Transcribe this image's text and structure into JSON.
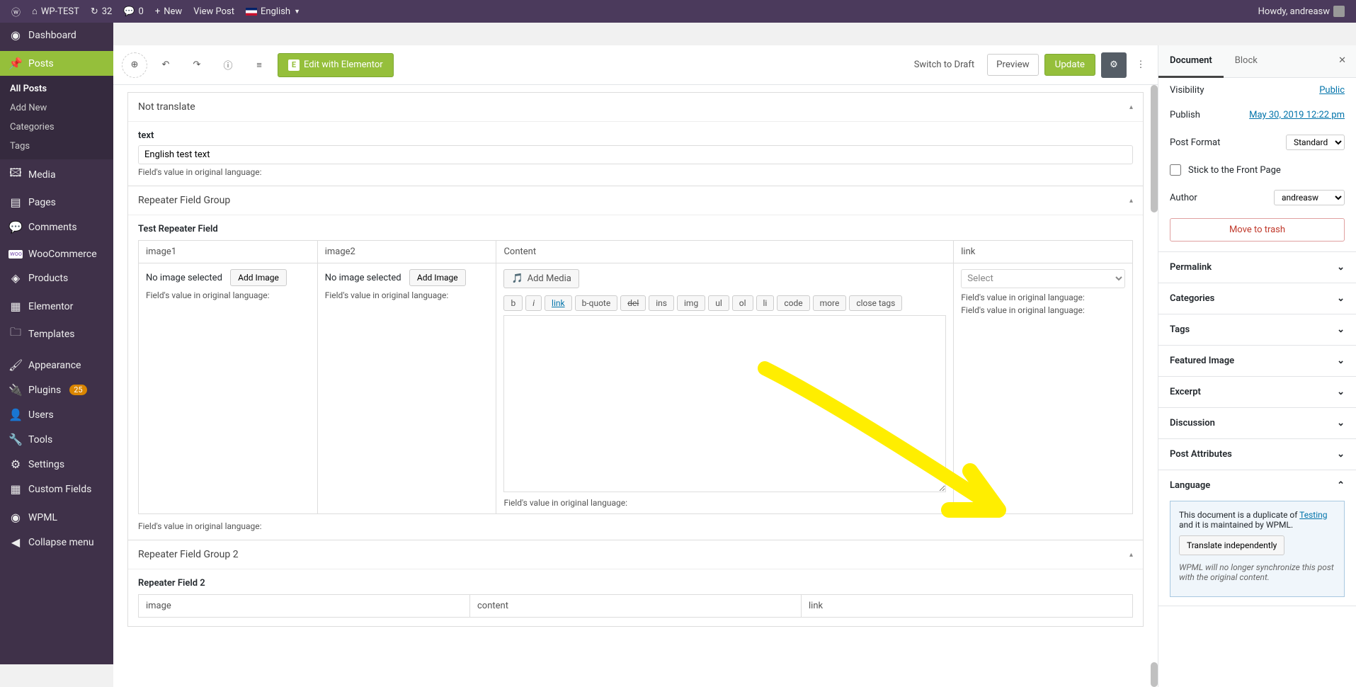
{
  "adminBar": {
    "siteName": "WP-TEST",
    "updates": "32",
    "comments": "0",
    "new": "New",
    "viewPost": "View Post",
    "language": "English",
    "howdy": "Howdy, andreasw"
  },
  "sidebar": {
    "dashboard": "Dashboard",
    "posts": "Posts",
    "postsSub": {
      "all": "All Posts",
      "addNew": "Add New",
      "categories": "Categories",
      "tags": "Tags"
    },
    "media": "Media",
    "pages": "Pages",
    "comments": "Comments",
    "woo": "WooCommerce",
    "products": "Products",
    "elementor": "Elementor",
    "templates": "Templates",
    "appearance": "Appearance",
    "plugins": "Plugins",
    "pluginsBadge": "25",
    "users": "Users",
    "tools": "Tools",
    "settings": "Settings",
    "customFields": "Custom Fields",
    "wpml": "WPML",
    "collapse": "Collapse menu"
  },
  "toolbar": {
    "elementor": "Edit with Elementor",
    "switchDraft": "Switch to Draft",
    "preview": "Preview",
    "update": "Update"
  },
  "panels": {
    "notTranslate": "Not translate",
    "textLabel": "text",
    "textValue": "English test text",
    "origLang": "Field's value in original language:",
    "repGroup": "Repeater Field Group",
    "repField": "Test Repeater Field",
    "cols": {
      "image1": "image1",
      "image2": "image2",
      "content": "Content",
      "link": "link"
    },
    "noImage": "No image selected",
    "addImage": "Add Image",
    "addMedia": "Add Media",
    "qtags": {
      "b": "b",
      "i": "i",
      "link": "link",
      "bquote": "b-quote",
      "del": "del",
      "ins": "ins",
      "img": "img",
      "ul": "ul",
      "ol": "ol",
      "li": "li",
      "code": "code",
      "more": "more",
      "closeTags": "close tags"
    },
    "selectPlaceholder": "Select",
    "repGroup2": "Repeater Field Group 2",
    "repField2": "Repeater Field 2",
    "cols2": {
      "image": "image",
      "content": "content",
      "link": "link"
    }
  },
  "settings": {
    "tabDoc": "Document",
    "tabBlock": "Block",
    "visibility": "Visibility",
    "visVal": "Public",
    "publish": "Publish",
    "publishVal": "May 30, 2019 12:22 pm",
    "postFormat": "Post Format",
    "formatVal": "Standard",
    "stick": "Stick to the Front Page",
    "author": "Author",
    "authorVal": "andreasw",
    "trash": "Move to trash",
    "acc": {
      "permalink": "Permalink",
      "categories": "Categories",
      "tags": "Tags",
      "featured": "Featured Image",
      "excerpt": "Excerpt",
      "discussion": "Discussion",
      "postAttr": "Post Attributes",
      "language": "Language"
    },
    "langBox": {
      "line1a": "This document is a duplicate of ",
      "line1link": "Testing",
      "line1b": " and it is maintained by WPML.",
      "btn": "Translate independently",
      "note": "WPML will no longer synchronize this post with the original content."
    }
  }
}
